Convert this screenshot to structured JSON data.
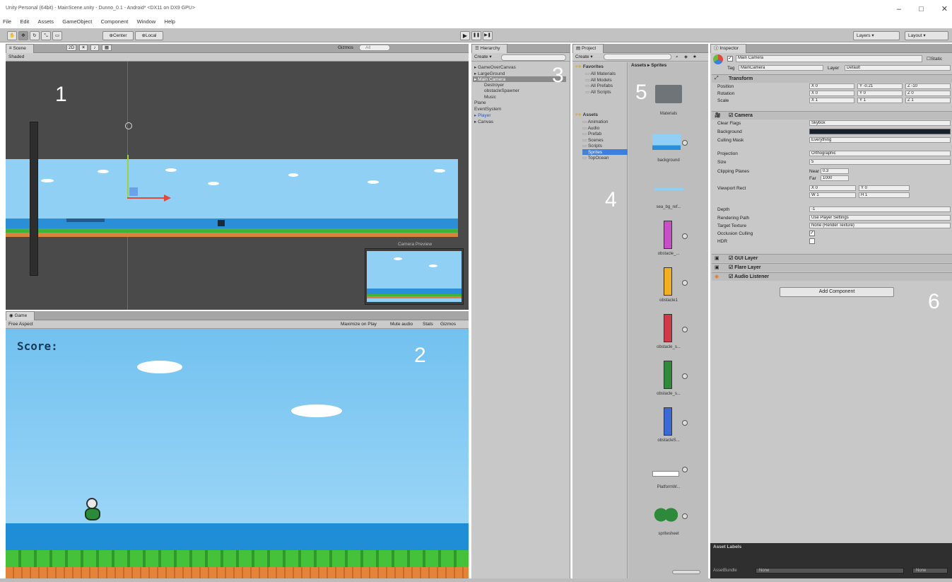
{
  "window": {
    "title": "Unity Personal (64bit) - MainScene.unity - Dunno_0.1 - Android* <DX11 on DX9 GPU>",
    "minimize": "–",
    "maximize": "□",
    "close": "✕"
  },
  "menu": [
    "File",
    "Edit",
    "Assets",
    "GameObject",
    "Component",
    "Window",
    "Help"
  ],
  "toolbar": {
    "pivot": "Center",
    "space": "Local",
    "play": "▶",
    "pause": "❚❚",
    "step": "▶❚",
    "layers": "Layers",
    "layout": "Layout"
  },
  "scene": {
    "tab": "Scene",
    "shading": "Shaded",
    "mode_2d": "2D",
    "gizmos": "Gizmos",
    "search_placeholder": "All",
    "panel_number": "1",
    "camera_preview": "Camera Preview"
  },
  "game": {
    "tab": "Game",
    "aspect": "Free Aspect",
    "options": [
      "Maximize on Play",
      "Mute audio",
      "Stats",
      "Gizmos"
    ],
    "score_label": "Score:",
    "panel_number": "2"
  },
  "hierarchy": {
    "tab": "Hierarchy",
    "create": "Create",
    "panel_number": "3",
    "items": [
      {
        "label": "GameOverCanvas",
        "indent": 0,
        "arrow": true,
        "selected": false
      },
      {
        "label": "LargeGround",
        "indent": 0,
        "arrow": true,
        "selected": false
      },
      {
        "label": "Main Camera",
        "indent": 0,
        "arrow": true,
        "selected": true
      },
      {
        "label": "Destroyer",
        "indent": 1,
        "arrow": false,
        "selected": false
      },
      {
        "label": "obstacleSpawner",
        "indent": 1,
        "arrow": false,
        "selected": false
      },
      {
        "label": "Music",
        "indent": 1,
        "arrow": false,
        "selected": false
      },
      {
        "label": "Plane",
        "indent": 0,
        "arrow": false,
        "selected": false
      },
      {
        "label": "EventSystem",
        "indent": 0,
        "arrow": false,
        "selected": false
      },
      {
        "label": "Player",
        "indent": 0,
        "arrow": true,
        "selected": false,
        "blue": true
      },
      {
        "label": "Canvas",
        "indent": 0,
        "arrow": true,
        "selected": false
      }
    ]
  },
  "project": {
    "tab": "Project",
    "create": "Create",
    "favorites_label": "Favorites",
    "favorites": [
      "All Materials",
      "All Models",
      "All Prefabs",
      "All Scripts"
    ],
    "assets_label": "Assets",
    "folders": [
      "Animation",
      "Audio",
      "Prefab",
      "Scenes",
      "Scripts",
      "Sprites",
      "TopOcean"
    ],
    "selected_folder": "Sprites",
    "breadcrumb": "Assets ▸ Sprites",
    "tree_number": "4",
    "grid_number": "5",
    "sprites": [
      {
        "name": "Materials",
        "kind": "folder"
      },
      {
        "name": "background",
        "kind": "sky"
      },
      {
        "name": "sea_bg_ref...",
        "kind": "line"
      },
      {
        "name": "obstacle_...",
        "kind": "pillar",
        "color": "#c84fc8"
      },
      {
        "name": "obstacle1",
        "kind": "pillar",
        "color": "#f0b020"
      },
      {
        "name": "obstacle_s...",
        "kind": "pillar",
        "color": "#d23a4a"
      },
      {
        "name": "obstacle_s...",
        "kind": "pillar",
        "color": "#2f8a3a"
      },
      {
        "name": "obstacleS...",
        "kind": "pillar",
        "color": "#3a6ad8"
      },
      {
        "name": "PlatformW...",
        "kind": "bar"
      },
      {
        "name": "spritesheet",
        "kind": "bird"
      }
    ]
  },
  "inspector": {
    "tab": "Inspector",
    "object_name": "Main Camera",
    "static_label": "Static",
    "tag_label": "Tag",
    "tag_value": "MainCamera",
    "layer_label": "Layer",
    "layer_value": "Default",
    "panel_number": "6",
    "transform": {
      "title": "Transform",
      "position_label": "Position",
      "rotation_label": "Rotation",
      "scale_label": "Scale",
      "position": [
        "0",
        "-0.21",
        "-10"
      ],
      "rotation": [
        "0",
        "0",
        "0"
      ],
      "scale": [
        "1",
        "1",
        "1"
      ]
    },
    "camera": {
      "title": "Camera",
      "clear_flags_label": "Clear Flags",
      "clear_flags": "Skybox",
      "background_label": "Background",
      "culling_mask_label": "Culling Mask",
      "culling_mask": "Everything",
      "projection_label": "Projection",
      "projection": "Orthographic",
      "size_label": "Size",
      "size": "5",
      "clipping_label": "Clipping Planes",
      "near_label": "Near",
      "near": "0.3",
      "far_label": "Far",
      "far": "1000",
      "viewport_label": "Viewport Rect",
      "viewport": [
        "0",
        "0",
        "1",
        "1"
      ],
      "depth_label": "Depth",
      "depth": "-1",
      "rendering_path_label": "Rendering Path",
      "rendering_path": "Use Player Settings",
      "target_texture_label": "Target Texture",
      "target_texture": "None (Render Texture)",
      "occlusion_label": "Occlusion Culling",
      "hdr_label": "HDR"
    },
    "components": [
      "GUI Layer",
      "Flare Layer",
      "Audio Listener"
    ],
    "add_component": "Add Component",
    "asset_labels": "Asset Labels",
    "assetbundle": "AssetBundle",
    "none1": "None",
    "none2": "None"
  },
  "colors": {
    "sky": "#7cc4ee",
    "sea": "#2a8fd6",
    "grass": "#3fb33a",
    "dirt": "#e0803a",
    "selection": "#3d7fe0"
  }
}
